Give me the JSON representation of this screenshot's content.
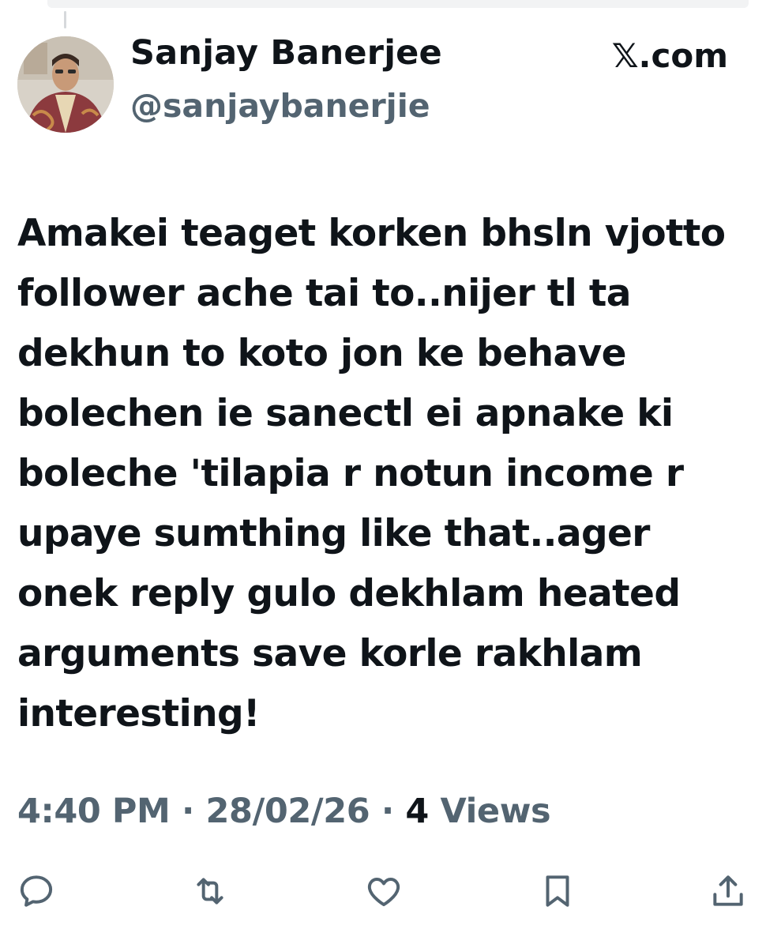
{
  "tweet": {
    "author_name": "Sanjay Banerjee",
    "author_handle": "@sanjaybanerjie",
    "brand": "𝕏.com",
    "text": "Amakei teaget korken bhsln vjotto\nfollower ache tai to..nijer tl ta\ndekhun to koto jon ke behave\nbolechen ie sanectl ei apnake ki\nboleche 'tilapia r notun income r\nupaye sumthing like that..ager\nonek reply gulo dekhlam heated\narguments save korle rakhlam\ninteresting!",
    "time": "4:40 PM",
    "date": "28/02/26",
    "separator": "·",
    "views_count": "4",
    "views_label": "Views"
  },
  "actions": [
    {
      "name": "reply",
      "icon": "reply-icon"
    },
    {
      "name": "retweet",
      "icon": "retweet-icon"
    },
    {
      "name": "like",
      "icon": "heart-icon"
    },
    {
      "name": "bookmark",
      "icon": "bookmark-icon"
    },
    {
      "name": "share",
      "icon": "share-icon"
    }
  ],
  "colors": {
    "text_primary": "#0f1419",
    "text_secondary": "#536471",
    "background": "#ffffff"
  }
}
